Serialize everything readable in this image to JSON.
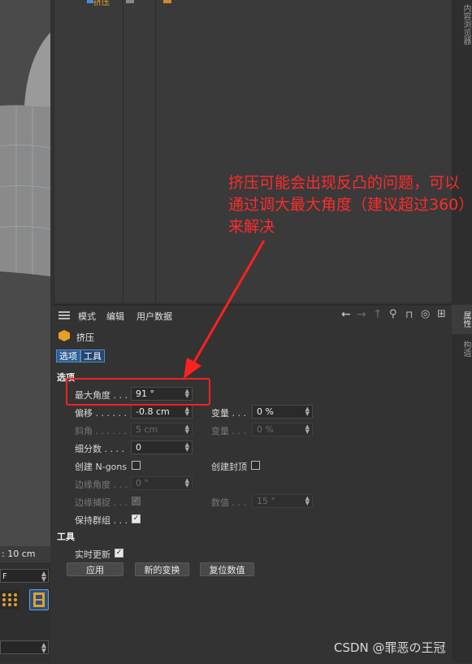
{
  "viewport": {
    "readout": ": 10 cm",
    "field_value": "F"
  },
  "right_tabs": {
    "browser": "内容浏览器",
    "attributes": "属性",
    "layers": "构造"
  },
  "attribute_manager": {
    "menu": {
      "mode": "模式",
      "edit": "编辑",
      "user_data": "用户数据"
    },
    "icons": [
      "arrow-left-icon",
      "arrow-right-icon",
      "arrow-up-icon",
      "search-icon",
      "lock-icon",
      "target-icon",
      "add-window-icon"
    ],
    "object_name": "挤压",
    "tabs": [
      {
        "label": "选项",
        "active": true
      },
      {
        "label": "工具",
        "active": false
      }
    ],
    "options_section": "选项",
    "fields": {
      "max_angle": {
        "label": "最大角度 . . .",
        "value": "91 °"
      },
      "offset": {
        "label": "偏移 . . . . . .",
        "value": "-0.8 cm"
      },
      "variance": {
        "label": "变量 . . .",
        "value": "0 %"
      },
      "bevel": {
        "label": "斜角 . . . . . .",
        "value": "5 cm"
      },
      "bevel_variance": {
        "label": "变量 . . .",
        "value": "0 %"
      },
      "subdivision": {
        "label": "细分数 . . . .",
        "value": "0"
      },
      "create_ngons": {
        "label": "创建 N-gons",
        "checked": false
      },
      "create_caps": {
        "label": "创建封顶",
        "checked": false
      },
      "edge_angle": {
        "label": "边缘角度 . . .",
        "value": "0 °"
      },
      "edge_snap": {
        "label": "边缘捕捉 . . .",
        "checked": true
      },
      "snap_value": {
        "label": "数值 . . .",
        "value": "15 °"
      },
      "preserve_groups": {
        "label": "保持群组 . . .",
        "checked": true
      }
    },
    "tools_section": "工具",
    "realtime_update": {
      "label": "实时更新",
      "checked": true
    },
    "buttons": {
      "apply": "应用",
      "new_transform": "新的变换",
      "reset": "复位数值"
    }
  },
  "object_manager": {
    "row_label": "挤压"
  },
  "annotation": {
    "text": "挤压可能会出现反凸的问题，可以通过调大最大角度（建议超过360）来解决",
    "color": "#ff2a2a"
  },
  "watermark": "CSDN @罪恶の王冠"
}
